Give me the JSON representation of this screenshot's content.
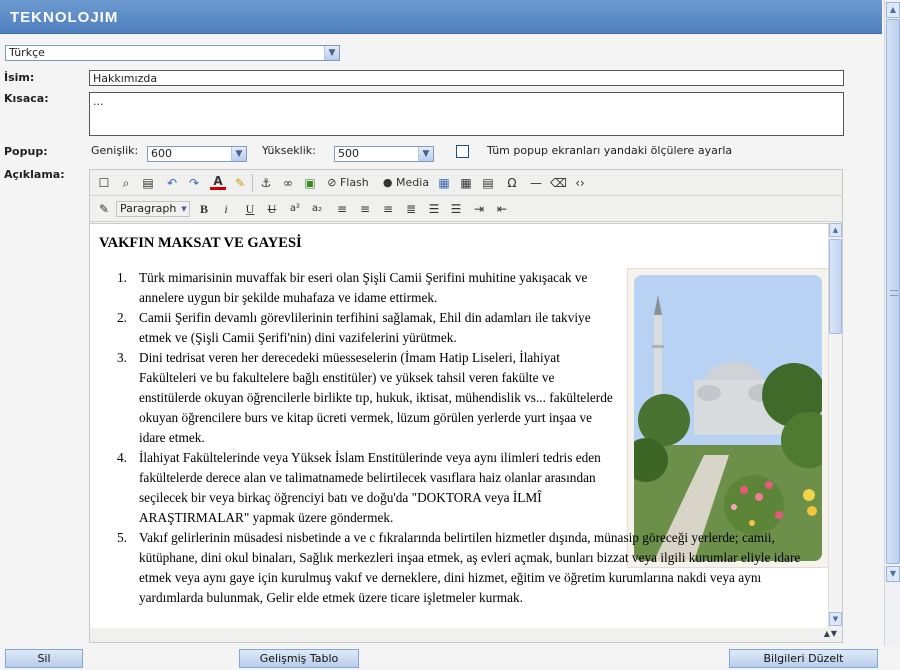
{
  "app": {
    "title": "TEKNOLOJIM"
  },
  "language_select": {
    "value": "Türkçe"
  },
  "fields": {
    "name_label": "İsim:",
    "name_value": "Hakkımızda",
    "short_label": "Kısaca:",
    "short_value": "...",
    "popup_label": "Popup:",
    "width_label": "Genişlik:",
    "width_value": "600",
    "height_label": "Yükseklik:",
    "height_value": "500",
    "all_popups_label": "Tüm popup ekranları yandaki ölçülere ayarla",
    "description_label": "Açıklama:"
  },
  "editor": {
    "toolbar1": [
      "new-document",
      "find",
      "paste-word",
      "undo",
      "redo",
      "text-color",
      "highlight",
      "anchor",
      "link",
      "image",
      "Flash",
      "Media",
      "table",
      "table-edit",
      "template",
      "special-char",
      "horizontal-rule",
      "remove-format",
      "source-code"
    ],
    "flash_label": "Flash",
    "media_label": "Media",
    "format_value": "Paragraph",
    "toolbar2": [
      "style-edit",
      "bold",
      "italic",
      "underline",
      "strikethrough",
      "superscript",
      "subscript",
      "align-left",
      "align-center",
      "align-right",
      "justify",
      "ordered-list",
      "unordered-list",
      "indent",
      "outdent"
    ],
    "bold_glyph": "B",
    "italic_glyph": "i",
    "underline_glyph": "U",
    "strike_glyph": "U",
    "sup_glyph": "a²",
    "sub_glyph": "a₂",
    "special_char_glyph": "Ω"
  },
  "document": {
    "heading": "VAKFIN MAKSAT VE GAYESİ",
    "items": [
      {
        "num": "1.",
        "text": "Türk mimarisinin muvaffak bir eseri olan Şişli Camii Şerifini muhitine yakışacak ve annelere uygun bir şekilde muhafaza ve idame ettirmek."
      },
      {
        "num": "2.",
        "text": "Camii Şerifin devamlı görevlilerinin terfihini sağlamak, Ehil din adamları ile takviye etmek ve (Şişli Camii Şerifi'nin) dini vazifelerini yürütmek."
      },
      {
        "num": "3.",
        "text": "Dini tedrisat veren her derecedeki müesseselerin (İmam Hatip Liseleri, İlahiyat Fakülteleri ve bu fakultelere bağlı enstitüler) ve yüksek tahsil veren fakülte ve enstitülerde okuyan öğrencilerle birlikte tıp, hukuk, iktisat, mühendislik vs... fakültelerde okuyan öğrencilere burs ve kitap ücreti vermek, lüzum görülen yerlerde yurt inşaa ve idare etmek."
      },
      {
        "num": "4.",
        "text": "İlahiyat Fakültelerinde veya Yüksek İslam Enstitülerinde veya aynı ilimleri tedris eden fakültelerde derece alan ve talimatnamede belirtilecek vasıflara haiz olanlar arasından seçilecek bir veya birkaç öğrenciyi batı ve doğu'da \"DOKTORA veya İLMÎ ARAŞTIRMALAR\" yapmak üzere göndermek."
      },
      {
        "num": "5.",
        "text": "Vakıf gelirlerinin müsadesi nisbetinde a ve c fıkralarında belirtilen hizmetler dışında, münasip göreceği yerlerde; camii, kütüphane, dini okul binaları, Sağlık merkezleri inşaa etmek, aş evleri açmak, bunları bizzat veya ilgili kurumlar eliyle idare etmek veya aynı gaye için kurulmuş vakıf ve derneklere, dini hizmet, eğitim ve öğretim kurumlarına nakdi veya aynı yardımlarda bulunmak, Gelir elde etmek üzere ticare işletmeler kurmak."
      }
    ]
  },
  "buttons": {
    "delete": "Sil",
    "advanced_table": "Gelişmiş Tablo",
    "update": "Bilgileri Düzelt"
  },
  "colors": {
    "header": "#5b89c8",
    "button": "#c7d9f1"
  }
}
